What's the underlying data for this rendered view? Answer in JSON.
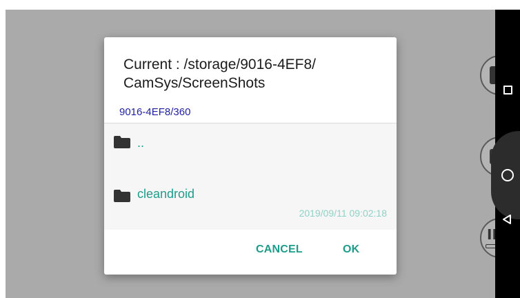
{
  "dialog": {
    "title": "Current : /storage/9016-4EF8/ CamSys/ScreenShots",
    "path": "9016-4EF8/360",
    "files": [
      {
        "name": "..",
        "date": ""
      },
      {
        "name": "cleandroid",
        "date": "2019/09/11 09:02:18"
      }
    ],
    "cancel_label": "CANCEL",
    "ok_label": "OK"
  },
  "background": {
    "button3_text": "IR"
  },
  "icons": {
    "folder": "folder-icon",
    "nav_recents": "square-icon",
    "nav_home": "circle-icon",
    "nav_back": "triangle-back-icon"
  },
  "colors": {
    "accent": "#1e9c8a",
    "path_link": "#1f1fa3",
    "date": "#8fd2c5",
    "scrim": "#aaaaaa",
    "navbar": "#000000"
  }
}
